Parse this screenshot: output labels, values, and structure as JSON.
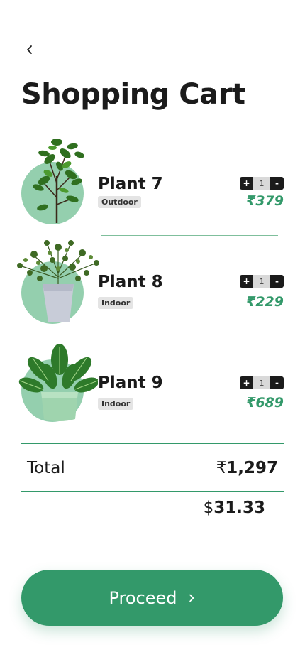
{
  "header": {
    "back_icon": "chevron-left-icon",
    "title": "Shopping Cart"
  },
  "items": [
    {
      "name": "Plant 7",
      "tag": "Outdoor",
      "qty": "1",
      "price": "₹379",
      "plus": "+",
      "minus": "-"
    },
    {
      "name": "Plant 8",
      "tag": "Indoor",
      "qty": "1",
      "price": "₹229",
      "plus": "+",
      "minus": "-"
    },
    {
      "name": "Plant 9",
      "tag": "Indoor",
      "qty": "1",
      "price": "₹689",
      "plus": "+",
      "minus": "-"
    }
  ],
  "summary": {
    "total_label": "Total",
    "total_currency": "₹",
    "total_amount": "1,297",
    "usd_currency": "$",
    "usd_amount": "31.33"
  },
  "proceed": {
    "label": "Proceed",
    "icon": "chevron-right-icon"
  },
  "colors": {
    "accent": "#33996a",
    "thumb_bg": "#94cfae",
    "stepper_dark": "#1b1b1b"
  }
}
